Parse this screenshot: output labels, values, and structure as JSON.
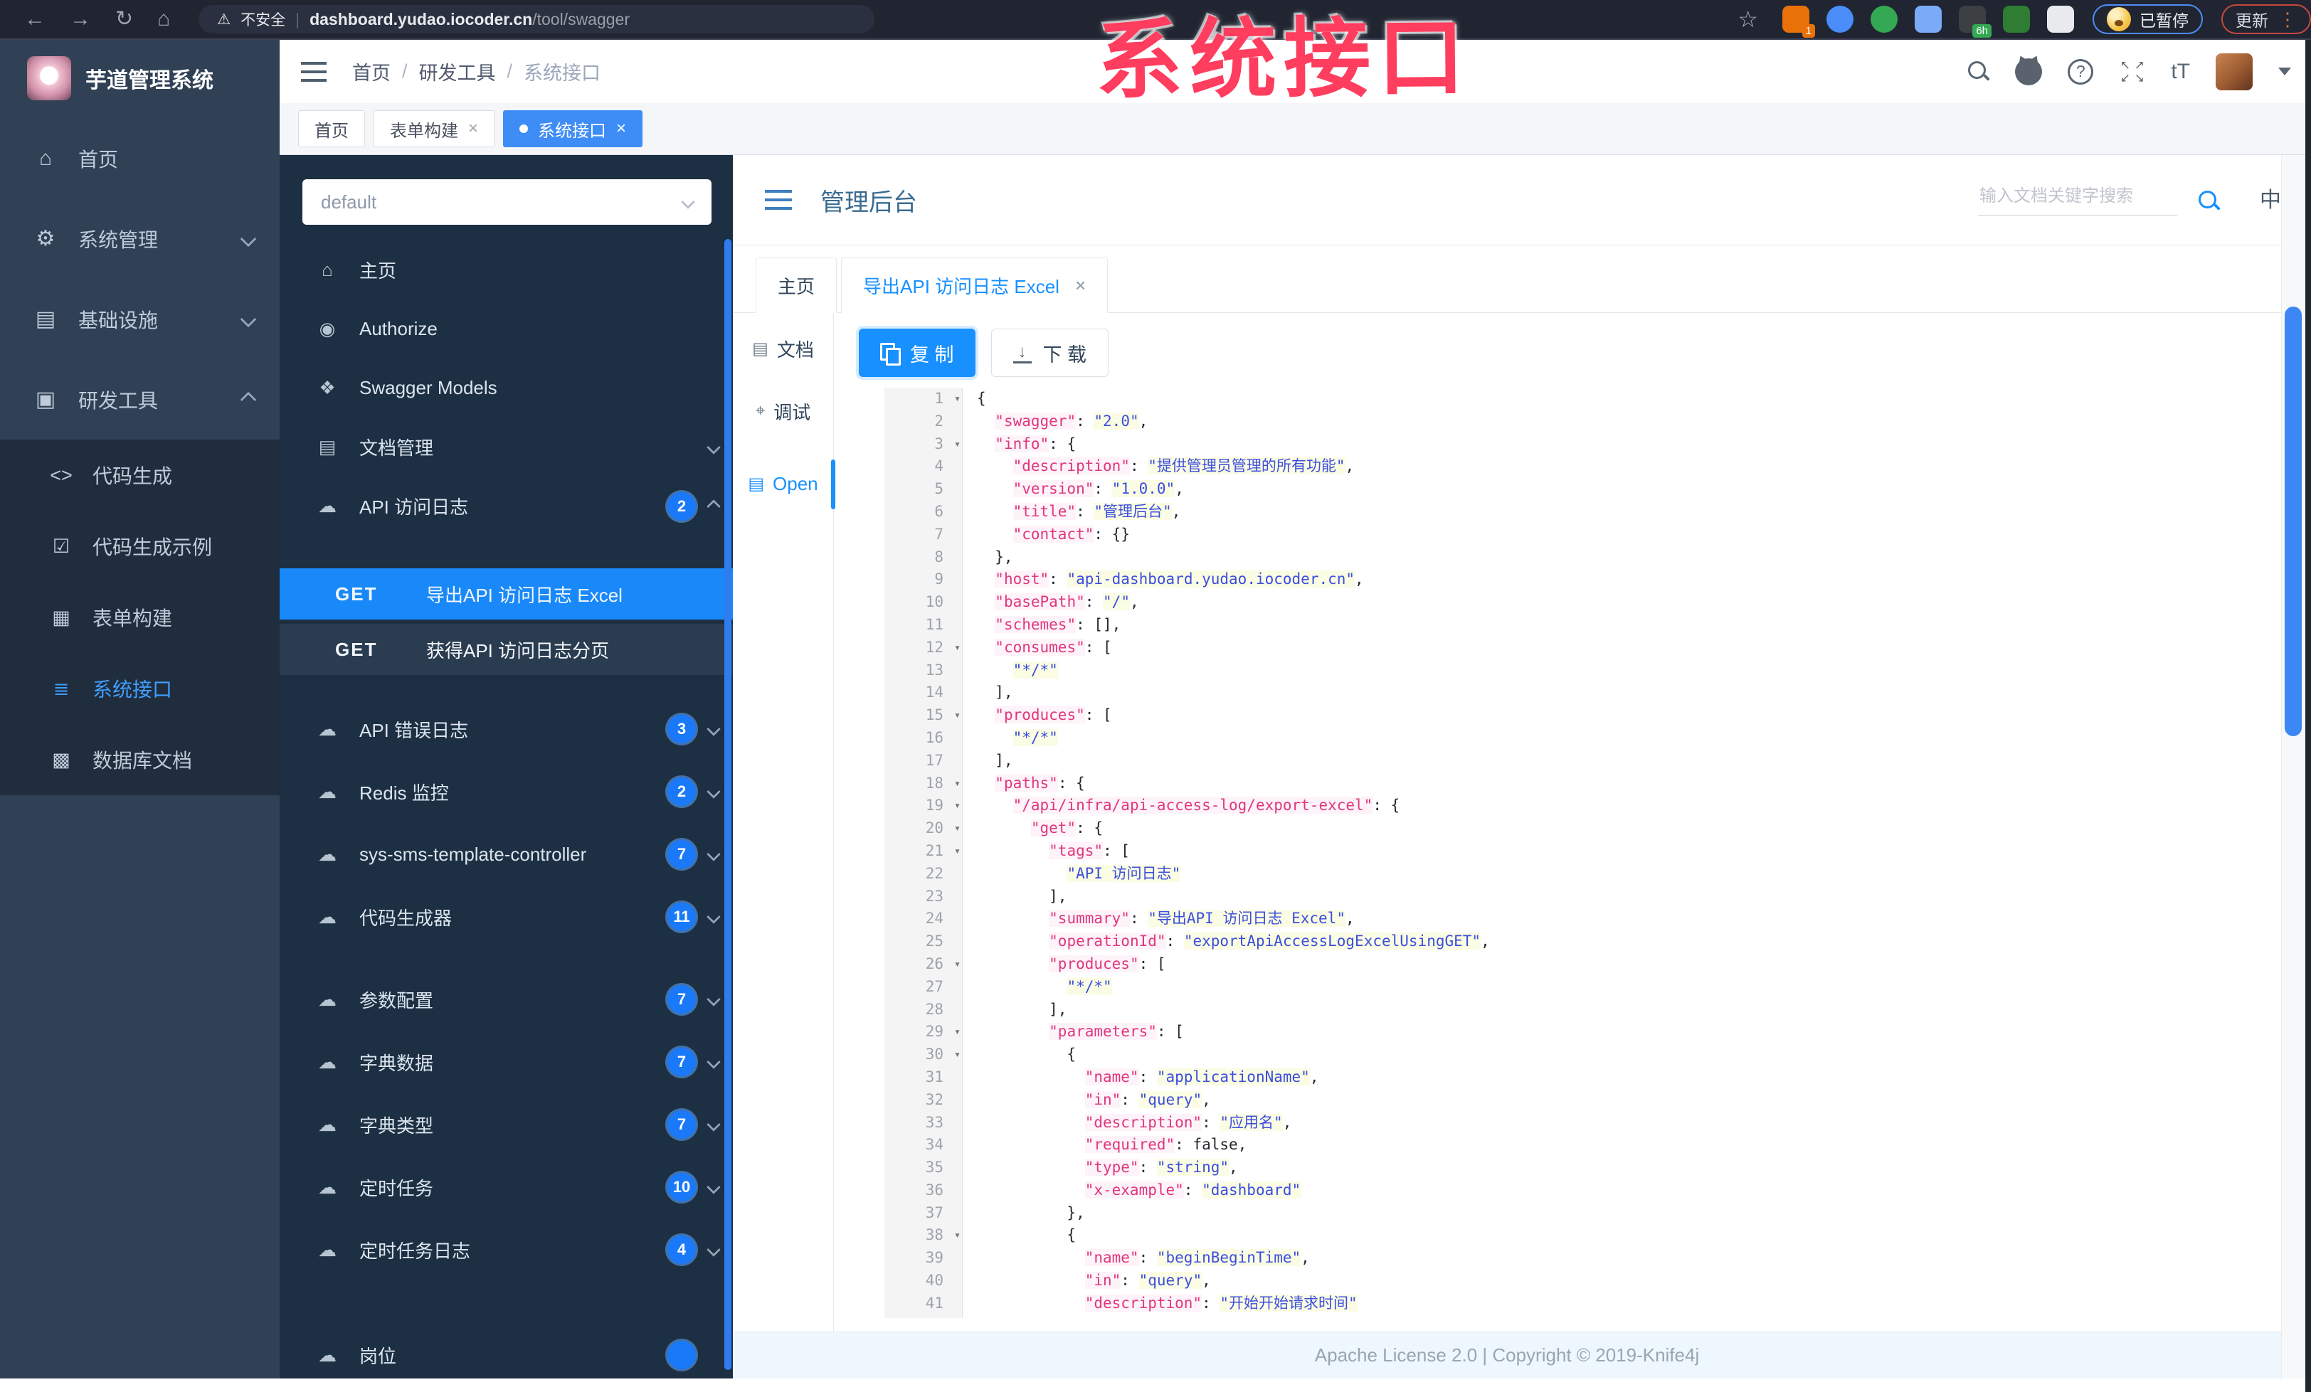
{
  "browser": {
    "back_glyph": "←",
    "forward_glyph": "→",
    "reload_glyph": "↻",
    "home_glyph": "⌂",
    "warning_glyph": "⚠",
    "warning_label": "不安全",
    "url_host": "dashboard.yudao.iocoder.cn",
    "url_path": "/tool/swagger",
    "bookmark_glyph": "☆",
    "extensions": [
      {
        "name": "extension-orange-icon",
        "color": "#e8710a",
        "badge": "1",
        "badge_color": "#e8710a"
      },
      {
        "name": "extension-blue-pin-icon",
        "color": "#4a8df8"
      },
      {
        "name": "extension-green-shield-icon",
        "color": "#34a853"
      },
      {
        "name": "extension-grid-icon",
        "color": "#7baaf7"
      },
      {
        "name": "extension-dark-icon",
        "color": "#3c4043",
        "badge": "6h",
        "badge_color": "#34a853"
      },
      {
        "name": "extension-green-bird-icon",
        "color": "#2e7d32"
      },
      {
        "name": "extension-white-paw-icon",
        "color": "#e8eaed"
      }
    ],
    "paused_label": "已暂停",
    "update_label": "更新",
    "menu_dots_glyph": "⋮"
  },
  "watermark": "系统接口",
  "sidebar": {
    "brand": "芋道管理系统",
    "items": [
      {
        "label": "首页",
        "icon": "home-icon",
        "glyph": "⌂"
      },
      {
        "label": "系统管理",
        "icon": "gear-icon",
        "glyph": "⚙",
        "chevron": "down"
      },
      {
        "label": "基础设施",
        "icon": "infrastructure-icon",
        "glyph": "▤",
        "chevron": "down"
      },
      {
        "label": "研发工具",
        "icon": "dev-tools-icon",
        "glyph": "▣",
        "chevron": "up"
      }
    ],
    "sub_items": [
      {
        "label": "代码生成",
        "icon": "code-icon",
        "glyph": "<>"
      },
      {
        "label": "代码生成示例",
        "icon": "code-example-icon",
        "glyph": "☑"
      },
      {
        "label": "表单构建",
        "icon": "form-builder-icon",
        "glyph": "▦"
      },
      {
        "label": "系统接口",
        "icon": "system-api-icon",
        "glyph": "≣",
        "active": true
      },
      {
        "label": "数据库文档",
        "icon": "database-doc-icon",
        "glyph": "▩"
      }
    ]
  },
  "header": {
    "breadcrumb": [
      "首页",
      "研发工具",
      "系统接口"
    ],
    "font_size_icon_label": "tT",
    "page_tabs": [
      {
        "label": "首页"
      },
      {
        "label": "表单构建",
        "closable": true
      },
      {
        "label": "系统接口",
        "closable": true,
        "active": true
      }
    ]
  },
  "api_panel": {
    "group_value": "default",
    "nav": [
      {
        "label": "主页",
        "icon": "home-icon",
        "glyph": "⌂"
      },
      {
        "label": "Authorize",
        "icon": "lock-icon",
        "glyph": "◉"
      },
      {
        "label": "Swagger Models",
        "icon": "models-icon",
        "glyph": "❖"
      },
      {
        "label": "文档管理",
        "icon": "doc-manage-icon",
        "glyph": "▤",
        "chevron": "down"
      },
      {
        "label": "API 访问日志",
        "icon": "cloud-icon",
        "glyph": "☁",
        "badge": "2",
        "chevron": "up"
      }
    ],
    "endpoints": [
      {
        "method": "GET",
        "label": "导出API 访问日志 Excel",
        "active": true
      },
      {
        "method": "GET",
        "label": "获得API 访问日志分页"
      }
    ],
    "groups": [
      {
        "label": "API 错误日志",
        "icon": "cloud-icon",
        "glyph": "☁",
        "badge": "3",
        "chevron": "down"
      },
      {
        "label": "Redis 监控",
        "icon": "cloud-icon",
        "glyph": "☁",
        "badge": "2",
        "chevron": "down"
      },
      {
        "label": "sys-sms-template-controller",
        "icon": "cloud-icon",
        "glyph": "☁",
        "badge": "7",
        "chevron": "down"
      },
      {
        "label": "代码生成器",
        "icon": "cloud-icon",
        "glyph": "☁",
        "badge": "11",
        "chevron": "down"
      },
      {
        "label": "参数配置",
        "icon": "cloud-icon",
        "glyph": "☁",
        "badge": "7",
        "chevron": "down",
        "gap": true
      },
      {
        "label": "字典数据",
        "icon": "cloud-icon",
        "glyph": "☁",
        "badge": "7",
        "chevron": "down"
      },
      {
        "label": "字典类型",
        "icon": "cloud-icon",
        "glyph": "☁",
        "badge": "7",
        "chevron": "down"
      },
      {
        "label": "定时任务",
        "icon": "cloud-icon",
        "glyph": "☁",
        "badge": "10",
        "chevron": "down"
      },
      {
        "label": "定时任务日志",
        "icon": "cloud-icon",
        "glyph": "☁",
        "badge": "4",
        "chevron": "down"
      },
      {
        "label": "岗位",
        "icon": "cloud-icon",
        "glyph": "☁",
        "badge": "",
        "tail": true
      }
    ]
  },
  "doc": {
    "title": "管理后台",
    "search_placeholder": "输入文档关键字搜索",
    "lang_label": "中",
    "tabs": [
      {
        "label": "主页"
      },
      {
        "label": "导出API 访问日志 Excel",
        "closable": true,
        "active": true
      }
    ],
    "side_tabs": [
      {
        "label": "文档",
        "icon": "doc-icon",
        "glyph": "▤"
      },
      {
        "label": "调试",
        "icon": "debug-icon",
        "glyph": "⌖"
      },
      {
        "label": "Open",
        "icon": "open-file-icon",
        "glyph": "▤",
        "active": true,
        "last": true
      }
    ],
    "copy_label": "复 制",
    "download_label": "下 载",
    "footer_text": "Apache License 2.0 | Copyright © 2019-Knife4j"
  },
  "code": {
    "fold_lines": [
      1,
      3,
      12,
      15,
      18,
      19,
      20,
      21,
      26,
      29,
      30,
      38
    ],
    "lines": [
      [
        [
          "p",
          "{"
        ]
      ],
      [
        [
          "p",
          "  "
        ],
        [
          "k",
          "\"swagger\""
        ],
        [
          "p",
          ": "
        ],
        [
          "s",
          "\"2.0\""
        ],
        [
          "p",
          ","
        ]
      ],
      [
        [
          "p",
          "  "
        ],
        [
          "k",
          "\"info\""
        ],
        [
          "p",
          ": {"
        ]
      ],
      [
        [
          "p",
          "    "
        ],
        [
          "k",
          "\"description\""
        ],
        [
          "p",
          ": "
        ],
        [
          "s",
          "\"提供管理员管理的所有功能\""
        ],
        [
          "p",
          ","
        ]
      ],
      [
        [
          "p",
          "    "
        ],
        [
          "k",
          "\"version\""
        ],
        [
          "p",
          ": "
        ],
        [
          "s",
          "\"1.0.0\""
        ],
        [
          "p",
          ","
        ]
      ],
      [
        [
          "p",
          "    "
        ],
        [
          "k",
          "\"title\""
        ],
        [
          "p",
          ": "
        ],
        [
          "s",
          "\"管理后台\""
        ],
        [
          "p",
          ","
        ]
      ],
      [
        [
          "p",
          "    "
        ],
        [
          "k",
          "\"contact\""
        ],
        [
          "p",
          ": {}"
        ]
      ],
      [
        [
          "p",
          "  },"
        ]
      ],
      [
        [
          "p",
          "  "
        ],
        [
          "k",
          "\"host\""
        ],
        [
          "p",
          ": "
        ],
        [
          "s",
          "\"api-dashboard.yudao.iocoder.cn\""
        ],
        [
          "p",
          ","
        ]
      ],
      [
        [
          "p",
          "  "
        ],
        [
          "k",
          "\"basePath\""
        ],
        [
          "p",
          ": "
        ],
        [
          "s",
          "\"/\""
        ],
        [
          "p",
          ","
        ]
      ],
      [
        [
          "p",
          "  "
        ],
        [
          "k",
          "\"schemes\""
        ],
        [
          "p",
          ": [],"
        ]
      ],
      [
        [
          "p",
          "  "
        ],
        [
          "k",
          "\"consumes\""
        ],
        [
          "p",
          ": ["
        ]
      ],
      [
        [
          "p",
          "    "
        ],
        [
          "s",
          "\"*/*\""
        ]
      ],
      [
        [
          "p",
          "  ],"
        ]
      ],
      [
        [
          "p",
          "  "
        ],
        [
          "k",
          "\"produces\""
        ],
        [
          "p",
          ": ["
        ]
      ],
      [
        [
          "p",
          "    "
        ],
        [
          "s",
          "\"*/*\""
        ]
      ],
      [
        [
          "p",
          "  ],"
        ]
      ],
      [
        [
          "p",
          "  "
        ],
        [
          "k",
          "\"paths\""
        ],
        [
          "p",
          ": {"
        ]
      ],
      [
        [
          "p",
          "    "
        ],
        [
          "k",
          "\"/api/infra/api-access-log/export-excel\""
        ],
        [
          "p",
          ": {"
        ]
      ],
      [
        [
          "p",
          "      "
        ],
        [
          "k",
          "\"get\""
        ],
        [
          "p",
          ": {"
        ]
      ],
      [
        [
          "p",
          "        "
        ],
        [
          "k",
          "\"tags\""
        ],
        [
          "p",
          ": ["
        ]
      ],
      [
        [
          "p",
          "          "
        ],
        [
          "s",
          "\"API 访问日志\""
        ]
      ],
      [
        [
          "p",
          "        ],"
        ]
      ],
      [
        [
          "p",
          "        "
        ],
        [
          "k",
          "\"summary\""
        ],
        [
          "p",
          ": "
        ],
        [
          "s",
          "\"导出API 访问日志 Excel\""
        ],
        [
          "p",
          ","
        ]
      ],
      [
        [
          "p",
          "        "
        ],
        [
          "k",
          "\"operationId\""
        ],
        [
          "p",
          ": "
        ],
        [
          "s",
          "\"exportApiAccessLogExcelUsingGET\""
        ],
        [
          "p",
          ","
        ]
      ],
      [
        [
          "p",
          "        "
        ],
        [
          "k",
          "\"produces\""
        ],
        [
          "p",
          ": ["
        ]
      ],
      [
        [
          "p",
          "          "
        ],
        [
          "s",
          "\"*/*\""
        ]
      ],
      [
        [
          "p",
          "        ],"
        ]
      ],
      [
        [
          "p",
          "        "
        ],
        [
          "k",
          "\"parameters\""
        ],
        [
          "p",
          ": ["
        ]
      ],
      [
        [
          "p",
          "          {"
        ]
      ],
      [
        [
          "p",
          "            "
        ],
        [
          "k",
          "\"name\""
        ],
        [
          "p",
          ": "
        ],
        [
          "s",
          "\"applicationName\""
        ],
        [
          "p",
          ","
        ]
      ],
      [
        [
          "p",
          "            "
        ],
        [
          "k",
          "\"in\""
        ],
        [
          "p",
          ": "
        ],
        [
          "s",
          "\"query\""
        ],
        [
          "p",
          ","
        ]
      ],
      [
        [
          "p",
          "            "
        ],
        [
          "k",
          "\"description\""
        ],
        [
          "p",
          ": "
        ],
        [
          "s",
          "\"应用名\""
        ],
        [
          "p",
          ","
        ]
      ],
      [
        [
          "p",
          "            "
        ],
        [
          "k",
          "\"required\""
        ],
        [
          "p",
          ": "
        ],
        [
          "b",
          "false"
        ],
        [
          "p",
          ","
        ]
      ],
      [
        [
          "p",
          "            "
        ],
        [
          "k",
          "\"type\""
        ],
        [
          "p",
          ": "
        ],
        [
          "s",
          "\"string\""
        ],
        [
          "p",
          ","
        ]
      ],
      [
        [
          "p",
          "            "
        ],
        [
          "k",
          "\"x-example\""
        ],
        [
          "p",
          ": "
        ],
        [
          "s",
          "\"dashboard\""
        ]
      ],
      [
        [
          "p",
          "          },"
        ]
      ],
      [
        [
          "p",
          "          {"
        ]
      ],
      [
        [
          "p",
          "            "
        ],
        [
          "k",
          "\"name\""
        ],
        [
          "p",
          ": "
        ],
        [
          "s",
          "\"beginBeginTime\""
        ],
        [
          "p",
          ","
        ]
      ],
      [
        [
          "p",
          "            "
        ],
        [
          "k",
          "\"in\""
        ],
        [
          "p",
          ": "
        ],
        [
          "s",
          "\"query\""
        ],
        [
          "p",
          ","
        ]
      ],
      [
        [
          "p",
          "            "
        ],
        [
          "k",
          "\"description\""
        ],
        [
          "p",
          ": "
        ],
        [
          "s",
          "\"开始开始请求时间\""
        ]
      ]
    ]
  }
}
